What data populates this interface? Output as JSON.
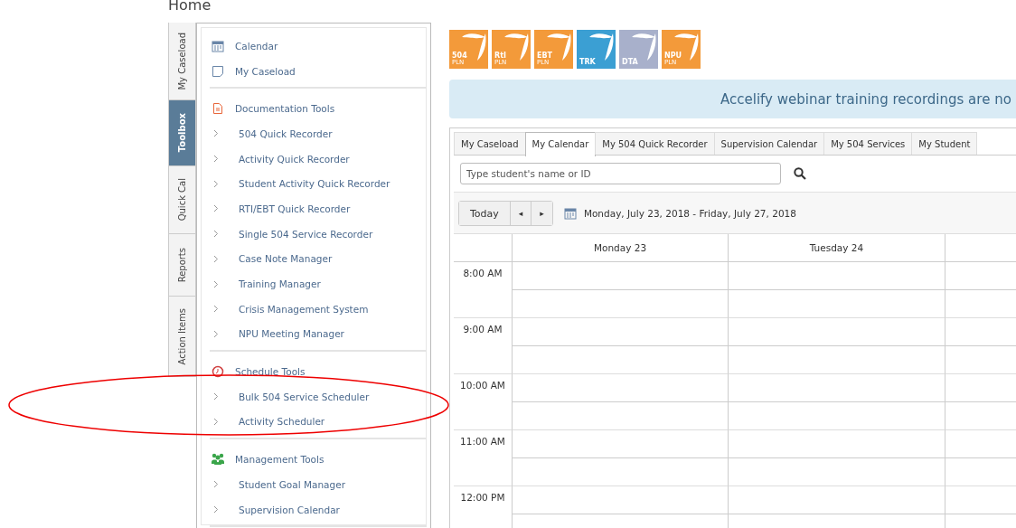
{
  "page_title": "Home",
  "side_tabs": [
    {
      "label": "My Caseload",
      "selected": false
    },
    {
      "label": "Toolbox",
      "selected": true
    },
    {
      "label": "Quick Cal",
      "selected": false
    },
    {
      "label": "Reports",
      "selected": false
    },
    {
      "label": "Action Items",
      "selected": false
    }
  ],
  "toolbox_sections": [
    {
      "kind": "links",
      "items": [
        {
          "label": "Calendar"
        },
        {
          "label": "My Caseload"
        }
      ]
    },
    {
      "kind": "group",
      "title": "Documentation Tools",
      "items": [
        "504 Quick Recorder",
        "Activity Quick Recorder",
        "Student Activity Quick Recorder",
        "RTI/EBT Quick Recorder",
        "Single 504 Service Recorder",
        "Case Note Manager",
        "Training Manager",
        "Crisis Management System",
        "NPU Meeting Manager"
      ]
    },
    {
      "kind": "group",
      "title": "Schedule Tools",
      "items": [
        "Bulk 504 Service Scheduler",
        "Activity Scheduler"
      ]
    },
    {
      "kind": "group",
      "title": "Management Tools",
      "items": [
        "Student Goal Manager",
        "Supervision Calendar"
      ]
    }
  ],
  "app_tiles": [
    {
      "label": "504",
      "sub": "PLN",
      "color": "#f39a3a"
    },
    {
      "label": "RtI",
      "sub": "PLN",
      "color": "#f39a3a"
    },
    {
      "label": "EBT",
      "sub": "PLN",
      "color": "#f39a3a"
    },
    {
      "label": "TRK",
      "color": "#3b9fd3"
    },
    {
      "label": "DTA",
      "color": "#a8b0cb"
    },
    {
      "label": "NPU",
      "sub": "PLN",
      "color": "#f39a3a"
    }
  ],
  "banner": "Accelify webinar training recordings are no",
  "tabs": [
    {
      "label": "My Caseload",
      "selected": false
    },
    {
      "label": "My Calendar",
      "selected": true
    },
    {
      "label": "My 504 Quick Recorder",
      "selected": false
    },
    {
      "label": "Supervision Calendar",
      "selected": false
    },
    {
      "label": "My 504 Services",
      "selected": false
    },
    {
      "label": "My Student",
      "selected": false
    }
  ],
  "search": {
    "placeholder": "Type student's name or ID"
  },
  "calendar": {
    "today_button": "Today",
    "prev_button": "◂",
    "next_button": "▸",
    "range": "Monday, July 23, 2018 - Friday, July 27, 2018",
    "columns": [
      "Monday 23",
      "Tuesday 24",
      ""
    ],
    "times": [
      "8:00 AM",
      "9:00 AM",
      "10:00 AM",
      "11:00 AM",
      "12:00 PM"
    ]
  }
}
